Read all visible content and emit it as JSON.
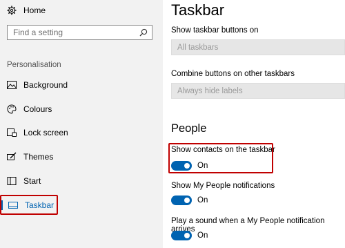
{
  "sidebar": {
    "home_label": "Home",
    "search_placeholder": "Find a setting",
    "section_label": "Personalisation",
    "items": [
      {
        "label": "Background",
        "icon": "picture-icon"
      },
      {
        "label": "Colours",
        "icon": "palette-icon"
      },
      {
        "label": "Lock screen",
        "icon": "lock-screen-icon"
      },
      {
        "label": "Themes",
        "icon": "brush-icon"
      },
      {
        "label": "Start",
        "icon": "start-icon"
      },
      {
        "label": "Taskbar",
        "icon": "taskbar-icon",
        "active": true
      }
    ]
  },
  "main": {
    "title": "Taskbar",
    "show_buttons_label": "Show taskbar buttons on",
    "show_buttons_value": "All taskbars",
    "combine_label": "Combine buttons on other taskbars",
    "combine_value": "Always hide labels",
    "people_heading": "People",
    "toggles": [
      {
        "label": "Show contacts on the taskbar",
        "state": "On"
      },
      {
        "label": "Show My People notifications",
        "state": "On"
      },
      {
        "label": "Play a sound when a My People notification arrives",
        "state": "On"
      }
    ]
  },
  "colors": {
    "accent": "#0063b1",
    "callout": "#c00000"
  }
}
